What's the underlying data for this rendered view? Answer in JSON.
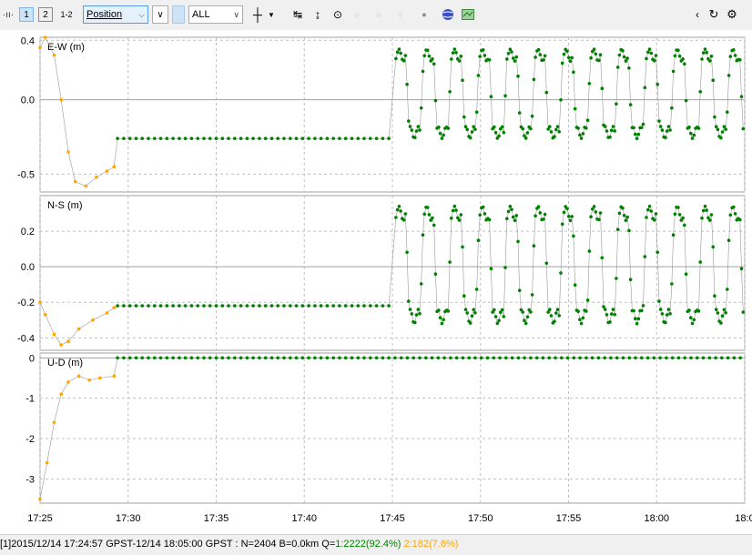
{
  "toolbar": {
    "btn1": "1",
    "btn2": "2",
    "btn12": "1-2",
    "plot_type": "Position",
    "sat_select": "ALL"
  },
  "colors": {
    "fix": "#008000",
    "float": "#ffa500",
    "grid": "#c0c0c0",
    "zero_line": "#a0a0a0"
  },
  "chart_data": [
    {
      "type": "scatter",
      "title": "E-W (m)",
      "ylim": [
        -0.62,
        0.42
      ],
      "yticks": [
        {
          "v": 0.0,
          "label": "0.0"
        },
        {
          "v": -0.5,
          "label": "-0.5"
        },
        {
          "v": 0.4,
          "label": "0.4"
        }
      ],
      "pattern": {
        "float_start": [
          [
            0,
            0.35
          ],
          [
            0.3,
            0.42
          ],
          [
            0.8,
            0.3
          ],
          [
            1.2,
            0.0
          ],
          [
            1.6,
            -0.35
          ],
          [
            2.0,
            -0.55
          ],
          [
            2.6,
            -0.58
          ],
          [
            3.2,
            -0.52
          ],
          [
            3.8,
            -0.48
          ],
          [
            4.2,
            -0.45
          ]
        ],
        "static_level": -0.26,
        "static_end": 20.0,
        "osc_high": 0.3,
        "osc_low": -0.22
      }
    },
    {
      "type": "scatter",
      "title": "N-S (m)",
      "ylim": [
        -0.47,
        0.4
      ],
      "yticks": [
        {
          "v": 0.2,
          "label": "0.2"
        },
        {
          "v": 0.0,
          "label": "0.0"
        },
        {
          "v": -0.2,
          "label": "-0.2"
        },
        {
          "v": -0.4,
          "label": "-0.4"
        }
      ],
      "pattern": {
        "float_start": [
          [
            0,
            -0.2
          ],
          [
            0.3,
            -0.27
          ],
          [
            0.8,
            -0.38
          ],
          [
            1.2,
            -0.44
          ],
          [
            1.6,
            -0.42
          ],
          [
            2.2,
            -0.35
          ],
          [
            3.0,
            -0.3
          ],
          [
            3.8,
            -0.26
          ],
          [
            4.2,
            -0.23
          ]
        ],
        "static_level": -0.22,
        "static_end": 20.0,
        "osc_high": 0.3,
        "osc_low": -0.28
      }
    },
    {
      "type": "scatter",
      "title": "U-D (m)",
      "ylim": [
        -3.6,
        0.12
      ],
      "yticks": [
        {
          "v": 0,
          "label": "0"
        },
        {
          "v": -1,
          "label": "-1"
        },
        {
          "v": -2,
          "label": "-2"
        },
        {
          "v": -3,
          "label": "-3"
        }
      ],
      "pattern": {
        "float_start": [
          [
            0,
            -3.5
          ],
          [
            0.4,
            -2.6
          ],
          [
            0.8,
            -1.6
          ],
          [
            1.2,
            -0.9
          ],
          [
            1.6,
            -0.6
          ],
          [
            2.2,
            -0.45
          ],
          [
            2.8,
            -0.55
          ],
          [
            3.4,
            -0.5
          ],
          [
            4.2,
            -0.45
          ]
        ],
        "static_level": 0.0,
        "static_end": 40.0,
        "osc_high": 0.0,
        "osc_low": -0.05
      }
    }
  ],
  "xaxis": {
    "xlim_min": [
      0,
      40
    ],
    "ticks": [
      {
        "v": 0,
        "label": "17:25"
      },
      {
        "v": 5,
        "label": "17:30"
      },
      {
        "v": 10,
        "label": "17:35"
      },
      {
        "v": 15,
        "label": "17:40"
      },
      {
        "v": 20,
        "label": "17:45"
      },
      {
        "v": 25,
        "label": "17:50"
      },
      {
        "v": 30,
        "label": "17:55"
      },
      {
        "v": 35,
        "label": "18:00"
      },
      {
        "v": 40,
        "label": "18:0"
      }
    ]
  },
  "status": {
    "prefix": "[1]2015/12/14 17:24:57 GPST-12/14 18:05:00 GPST : N=2404 B=0.0km Q=",
    "q1": "1:2222(92.4%)",
    "q2": "2:182(7.6%)"
  }
}
